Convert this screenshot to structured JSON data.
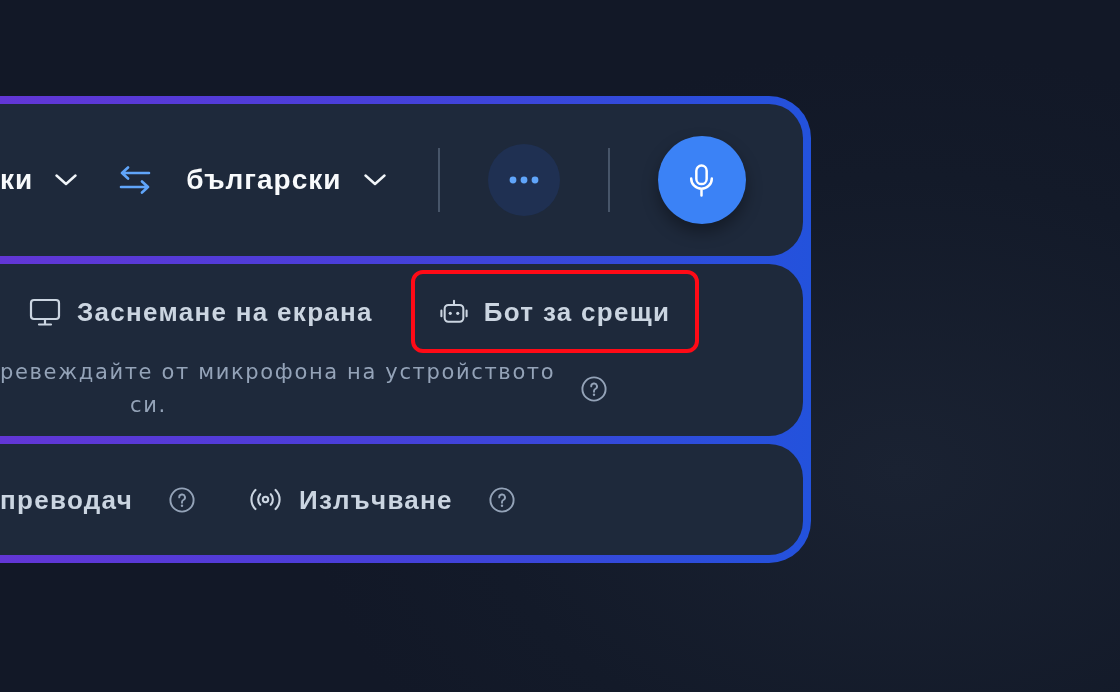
{
  "language_bar": {
    "source_language": "ки",
    "target_language": "български"
  },
  "modes": [
    {
      "label": "Заснемане на екрана",
      "kind": "screen",
      "selected": false,
      "highlighted": false
    },
    {
      "label": "Бот за срещи",
      "kind": "bot",
      "selected": false,
      "highlighted": true
    }
  ],
  "mode_description": "ревеждайте от микрофона на устройството си.",
  "features": [
    {
      "label": "преводач",
      "kind": "text"
    },
    {
      "label": "Излъчване",
      "kind": "broadcast"
    }
  ]
}
